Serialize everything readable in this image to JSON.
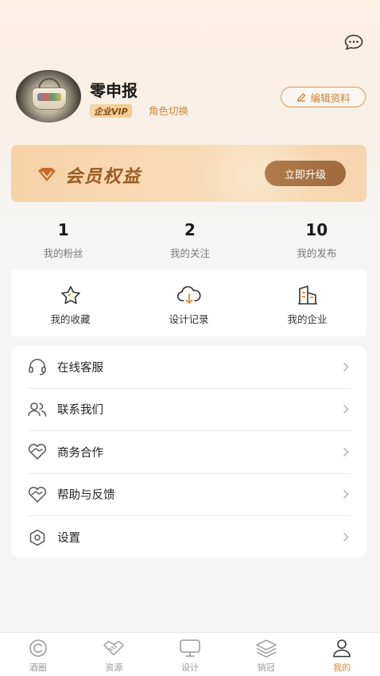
{
  "header": {
    "message_icon": "chat-bubble-icon"
  },
  "profile": {
    "nickname": "零申报",
    "vip_tag": "企业VIP",
    "role_switch": "角色切换",
    "edit_button": "编辑资料"
  },
  "vip_card": {
    "title": "会员权益",
    "upgrade_button": "立即升级"
  },
  "stats": [
    {
      "value": "1",
      "label": "我的粉丝"
    },
    {
      "value": "2",
      "label": "我的关注"
    },
    {
      "value": "10",
      "label": "我的发布"
    }
  ],
  "quick": [
    {
      "label": "我的收藏",
      "icon": "star-icon"
    },
    {
      "label": "设计记录",
      "icon": "cloud-download-icon"
    },
    {
      "label": "我的企业",
      "icon": "building-icon"
    }
  ],
  "menu": [
    {
      "label": "在线客服",
      "icon": "headset-icon"
    },
    {
      "label": "联系我们",
      "icon": "users-icon"
    },
    {
      "label": "商务合作",
      "icon": "handshake-heart-icon"
    },
    {
      "label": "帮助与反馈",
      "icon": "heart-help-icon"
    },
    {
      "label": "设置",
      "icon": "settings-icon"
    }
  ],
  "tabs": [
    {
      "label": "酒圈",
      "icon": "circle-icon"
    },
    {
      "label": "资源",
      "icon": "handshake-icon"
    },
    {
      "label": "设计",
      "icon": "monitor-icon"
    },
    {
      "label": "销冠",
      "icon": "layers-icon"
    },
    {
      "label": "我的",
      "icon": "person-icon",
      "active": true
    }
  ],
  "colors": {
    "accent": "#c98a3c",
    "vip_brown": "#9e6b3e"
  }
}
